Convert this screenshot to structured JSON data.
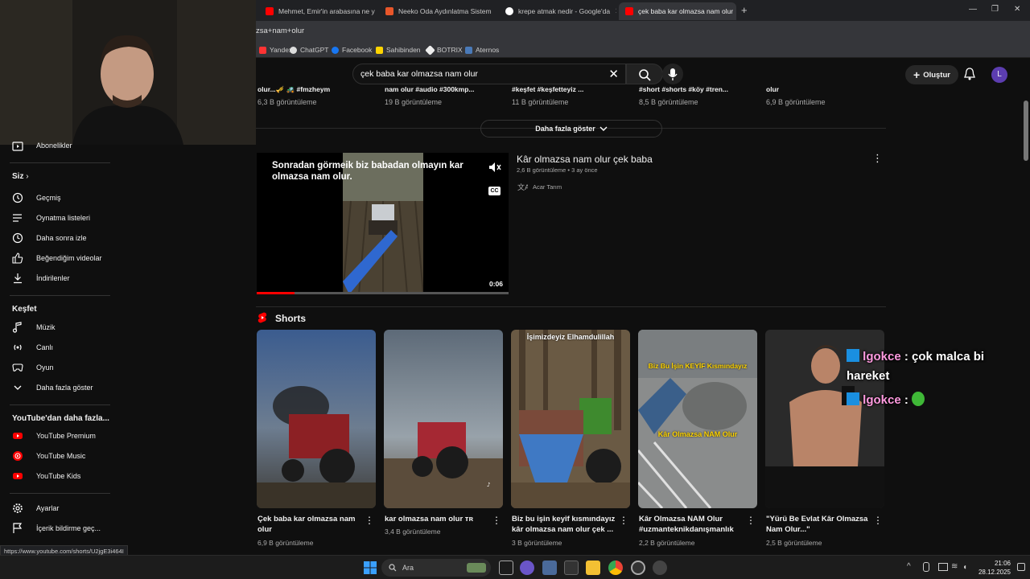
{
  "browser": {
    "tabs": [
      {
        "title": "Mehmet, Emir'in arabasına ne y",
        "color": "#ff0000"
      },
      {
        "title": "Neeko Oda Aydınlatma Sistem",
        "color": "#e8562a"
      },
      {
        "title": "krepe atmak nedir - Google'da",
        "color": "#ffffff"
      },
      {
        "title": "çek baba kar olmazsa nam olur",
        "color": "#ff0000"
      }
    ],
    "new_tab": "+",
    "url": "zsa+nam+olur",
    "bookmarks": [
      "Yandex",
      "ChatGPT",
      "Facebook",
      "Sahibinden",
      "BOTRIX",
      "Aternos"
    ]
  },
  "youtube": {
    "search_query": "çek baba kar olmazsa nam olur",
    "create_label": "Oluştur",
    "avatar_letter": "L"
  },
  "sidebar": {
    "subscriptions": "Abonelikler",
    "you_header": "Siz",
    "you_items": [
      "Geçmiş",
      "Oynatma listeleri",
      "Daha sonra izle",
      "Beğendiğim videolar",
      "İndirilenler"
    ],
    "explore_header": "Keşfet",
    "explore_items": [
      "Müzik",
      "Canlı",
      "Oyun",
      "Daha fazla göster"
    ],
    "more_header": "YouTube'dan daha fazla...",
    "more_items": [
      "YouTube Premium",
      "YouTube Music",
      "YouTube Kids"
    ],
    "settings_items": [
      "Ayarlar",
      "İçerik bildirme geç..."
    ]
  },
  "top_row": {
    "clipped_titles": [
      "olur...🎺 🚜 #fmzheym",
      "nam olur #audio #300kmp...",
      "#keşfet #keşfetteyiz ...",
      "#short #shorts #köy #tren...",
      "olur"
    ],
    "views": [
      "6,3 B görüntüleme",
      "19 B görüntüleme",
      "11 B görüntüleme",
      "8,5 B görüntüleme",
      "6,9 B görüntüleme"
    ],
    "show_more": "Daha fazla göster"
  },
  "featured": {
    "overlay_title": "Sonradan görmeik biz babadan olmayın kar olmazsa nam olur.",
    "duration": "0:06",
    "progress": 0.15,
    "title": "Kâr olmazsa nam olur çek baba",
    "stats": "2,6 B görüntüleme • 3 ay önce",
    "channel": "Acar Tarım",
    "cc": "CC"
  },
  "shorts": {
    "header": "Shorts",
    "items": [
      {
        "title": "Çek baba kar olmazsa nam olur",
        "views": "6,9 B görüntüleme"
      },
      {
        "title": "kar olmazsa nam olur ᴛʀ",
        "views": "3,4 B görüntüleme"
      },
      {
        "title": "Biz bu işin keyif kısmındayız kâr olmazsa nam olur çek ...",
        "views": "3 B görüntüleme"
      },
      {
        "title": "Kâr Olmazsa NAM Olur #uzmanteknikdanışmanlık",
        "views": "2,2 B görüntüleme"
      },
      {
        "title": "\"Yürü Be Evlat Kâr Olmazsa Nam Olur...\"",
        "views": "2,5 B görüntüleme"
      }
    ],
    "overlay_texts": [
      "İşimizdeyiz Elhamdulillah",
      "Biz Bu İşin KEYİF Kısmındayız",
      "Kâr Olmazsa NAM Olur"
    ]
  },
  "chat": [
    {
      "name": "lgokce",
      "message": ": çok malca bi hareket"
    },
    {
      "name": "lgokce",
      "message": ":"
    }
  ],
  "status_url": "https://www.youtube.com/shorts/U2jgE3i464I",
  "taskbar": {
    "search": "Ara",
    "time": "21:06",
    "date": "28.12.2025"
  }
}
